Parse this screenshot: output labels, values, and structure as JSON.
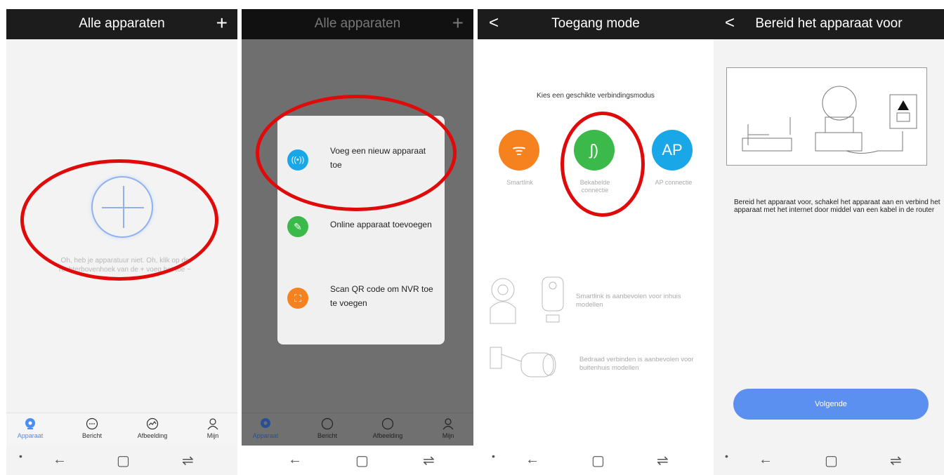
{
  "colors": {
    "accent": "#4b8cf5",
    "annotation_red": "#e10a0a",
    "smartlink": "#f5821f",
    "wired": "#3cb94b",
    "ap": "#1aa7e8",
    "scan": "#f5821f"
  },
  "panel1": {
    "title": "Alle apparaten",
    "add_icon": "plus-icon",
    "empty_text": "Oh, heb je apparatuur niet. Oh, klik op de rechterbovenhoek van de + voeg het toe ~",
    "nav": [
      {
        "label": "Apparaat",
        "icon": "camera-icon",
        "active": true
      },
      {
        "label": "Bericht",
        "icon": "message-icon"
      },
      {
        "label": "Afbeelding",
        "icon": "gallery-icon"
      },
      {
        "label": "Mijn",
        "icon": "user-icon"
      }
    ]
  },
  "panel2": {
    "title": "Alle apparaten",
    "menu": [
      {
        "label": "Voeg een nieuw apparaat toe",
        "icon": "wireless-icon"
      },
      {
        "label": "Online apparaat toevoegen",
        "icon": "edit-icon"
      },
      {
        "label": "Scan QR code om NVR toe te voegen",
        "icon": "scan-icon"
      }
    ],
    "nav": [
      {
        "label": "Apparaat"
      },
      {
        "label": "Bericht"
      },
      {
        "label": "Afbeelding"
      },
      {
        "label": "Mijn"
      }
    ]
  },
  "panel3": {
    "title": "Toegang mode",
    "subtitle": "Kies een geschikte verbindingsmodus",
    "modes": [
      {
        "label": "Smartlink",
        "icon": "wifi-icon"
      },
      {
        "label": "Bekabelde connectie",
        "icon": "cable-icon"
      },
      {
        "label": "AP connectie",
        "icon_text": "AP"
      }
    ],
    "hint_indoor": "Smartlink is aanbevolen voor inhuis modellen",
    "hint_outdoor": "Bedraad verbinden is aanbevolen voor buitenhuis modellen"
  },
  "panel4": {
    "title": "Bereid het apparaat voor",
    "instruction": "Bereid het apparaat voor, schakel het apparaat aan en verbind het apparaat met het internet door middel van een kabel in de router",
    "next_label": "Volgende"
  },
  "system_nav": {
    "back": "←",
    "recents": "▢",
    "switch": "⇌",
    "dot": "•"
  }
}
